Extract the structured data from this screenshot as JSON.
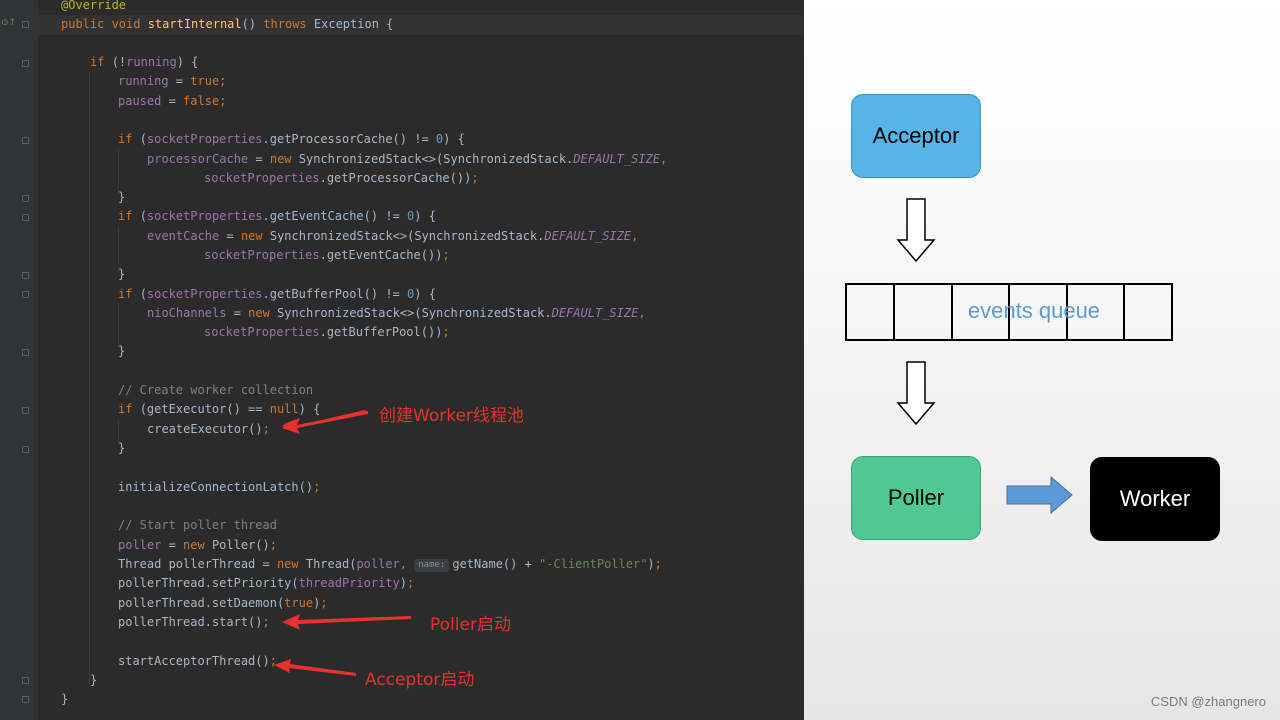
{
  "editor": {
    "lines": {
      "l01": "@Override",
      "l02": {
        "kw": "public void ",
        "fn": "startInternal",
        "rest": "() ",
        "kw2": "throws ",
        "rest2": "Exception {"
      },
      "l03": {
        "kw": "if ",
        "a": "(!",
        "f": "running",
        "b": ") {"
      },
      "l04": {
        "f": "running",
        "a": " = ",
        "kw": "true",
        "b": ";"
      },
      "l05": {
        "f": "paused",
        "a": " = ",
        "kw": "false",
        "b": ";"
      },
      "l06": {
        "kw": "if ",
        "a": "(",
        "f": "socketProperties",
        "b": ".getProcessorCache() != ",
        "n": "0",
        "c": ") {"
      },
      "l07": {
        "f": "processorCache",
        "a": " = ",
        "kw": "new ",
        "b": "SynchronizedStack<>(SynchronizedStack.",
        "cst": "DEFAULT_SIZE",
        "c": ","
      },
      "l08": {
        "f": "socketProperties",
        "a": ".getProcessorCache())",
        "b": ";"
      },
      "l09": "}",
      "l10": {
        "kw": "if ",
        "a": "(",
        "f": "socketProperties",
        "b": ".getEventCache() != ",
        "n": "0",
        "c": ") {"
      },
      "l11": {
        "f": "eventCache",
        "a": " = ",
        "kw": "new ",
        "b": "SynchronizedStack<>(SynchronizedStack.",
        "cst": "DEFAULT_SIZE",
        "c": ","
      },
      "l12": {
        "f": "socketProperties",
        "a": ".getEventCache())",
        "b": ";"
      },
      "l13": "}",
      "l14": {
        "kw": "if ",
        "a": "(",
        "f": "socketProperties",
        "b": ".getBufferPool() != ",
        "n": "0",
        "c": ") {"
      },
      "l15": {
        "f": "nioChannels",
        "a": " = ",
        "kw": "new ",
        "b": "SynchronizedStack<>(SynchronizedStack.",
        "cst": "DEFAULT_SIZE",
        "c": ","
      },
      "l16": {
        "f": "socketProperties",
        "a": ".getBufferPool())",
        "b": ";"
      },
      "l17": "}",
      "l18": "// Create worker collection",
      "l19": {
        "kw": "if ",
        "a": "(getExecutor() == ",
        "kw2": "null",
        "b": ") {"
      },
      "l20": {
        "a": "createExecutor()",
        "b": ";"
      },
      "l21": "}",
      "l22": {
        "a": "initializeConnectionLatch()",
        "b": ";"
      },
      "l23": "// Start poller thread",
      "l24": {
        "f": "poller",
        "a": " = ",
        "kw": "new ",
        "b": "Poller()",
        "c": ";"
      },
      "l25": {
        "a": "Thread pollerThread = ",
        "kw": "new ",
        "b": "Thread(",
        "f": "poller",
        "c": ", ",
        "hint": "name:",
        "d": "getName() + ",
        "s": "\"-ClientPoller\"",
        "e": ")",
        "z": ";"
      },
      "l26": {
        "a": "pollerThread.setPriority(",
        "f": "threadPriority",
        "b": ")",
        "c": ";"
      },
      "l27": {
        "a": "pollerThread.setDaemon(",
        "kw": "true",
        "b": ")",
        "c": ";"
      },
      "l28": {
        "a": "pollerThread.start()",
        "b": ";"
      },
      "l29": {
        "a": "startAcceptorThread()",
        "b": ";"
      },
      "l30": "}",
      "l31": "}"
    }
  },
  "annotations": {
    "worker_pool": "创建Worker线程池",
    "poller_start": "Poller启动",
    "acceptor_start": "Acceptor启动"
  },
  "diagram": {
    "acceptor": "Acceptor",
    "queue_label": "events queue",
    "poller": "Poller",
    "worker": "Worker",
    "colors": {
      "acceptor": "#56b4e9",
      "poller": "#4fc991",
      "worker": "#000000",
      "queue_text": "#5b9bd5",
      "arrow": "#5b9bd5",
      "annotation": "#e8312f"
    }
  },
  "watermark": "CSDN @zhangnero"
}
